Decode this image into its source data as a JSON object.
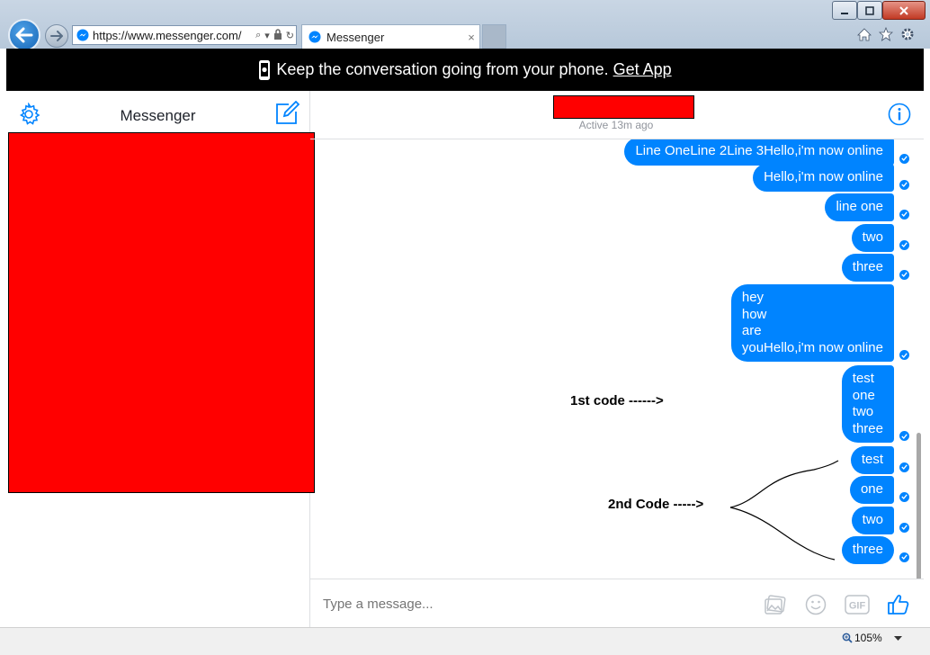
{
  "browser": {
    "url": "https://www.messenger.com/",
    "tab_title": "Messenger",
    "tab_close": "×",
    "zoom": "105%"
  },
  "banner": {
    "text": "Keep the conversation going from your phone.",
    "link": "Get App"
  },
  "sidebar": {
    "title": "Messenger"
  },
  "conversation": {
    "active_status": "Active 13m ago",
    "messages": [
      "Line OneLine 2Line 3Hello,i'm now online",
      "Hello,i'm now online",
      "line one",
      "two",
      "three",
      "hey\nhow\nare\nyouHello,i'm now online",
      "test\none\ntwo\nthree",
      "test",
      "one",
      "two",
      "three"
    ],
    "annotations": {
      "first": "1st code ------>",
      "second": "2nd Code ----->"
    }
  },
  "composer": {
    "placeholder": "Type a message..."
  },
  "colors": {
    "messenger_blue": "#0084ff",
    "redaction": "#ff0000",
    "banner_bg": "#000000"
  },
  "icons": {
    "settings": "gear-icon",
    "compose": "compose-icon",
    "info": "info-icon",
    "photo": "photo-icon",
    "sticker": "smiley-icon",
    "gif": "gif-icon",
    "like": "thumbs-up-icon"
  }
}
